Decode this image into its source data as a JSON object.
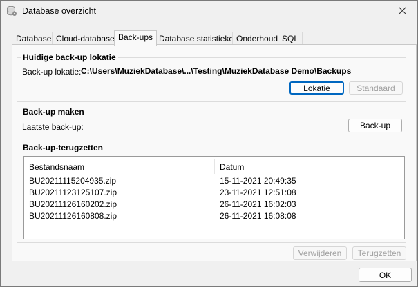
{
  "window": {
    "title": "Database overzicht",
    "app_icon": "database-icon",
    "close_icon": "close-icon"
  },
  "tabs": [
    {
      "label": "Database",
      "active": false
    },
    {
      "label": "Cloud-databases",
      "active": false
    },
    {
      "label": "Back-ups",
      "active": true
    },
    {
      "label": "Database statistieken",
      "active": false
    },
    {
      "label": "Onderhoud",
      "active": false
    },
    {
      "label": "SQL",
      "active": false
    }
  ],
  "location_group": {
    "title": "Huidige back-up lokatie",
    "label": "Back-up lokatie:",
    "path": "C:\\Users\\MuziekDatabase\\...\\Testing\\MuziekDatabase Demo\\Backups",
    "location_button": "Lokatie",
    "default_button": "Standaard"
  },
  "make_group": {
    "title": "Back-up maken",
    "last_label": "Laatste back-up:",
    "backup_button": "Back-up"
  },
  "restore_group": {
    "title": "Back-up-terugzetten",
    "columns": [
      "Bestandsnaam",
      "Datum"
    ],
    "rows": [
      {
        "file": "BU20211115204935.zip",
        "date": "15-11-2021 20:49:35"
      },
      {
        "file": "BU20211123125107.zip",
        "date": "23-11-2021 12:51:08"
      },
      {
        "file": "BU20211126160202.zip",
        "date": "26-11-2021 16:02:03"
      },
      {
        "file": "BU20211126160808.zip",
        "date": "26-11-2021 16:08:08"
      }
    ],
    "delete_button": "Verwijderen",
    "restore_button": "Terugzetten"
  },
  "footer": {
    "ok_button": "OK"
  },
  "colors": {
    "accent": "#0067c0",
    "disabled_text": "#a0a0a0"
  }
}
